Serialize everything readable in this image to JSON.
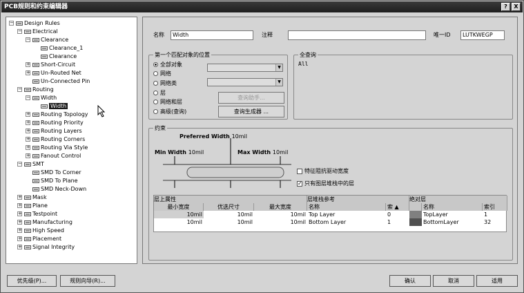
{
  "window": {
    "title": "PCB规则和约束编辑器",
    "help": "?",
    "close": "X"
  },
  "tree": [
    {
      "label": "Design Rules",
      "exp": "−",
      "lv": 0,
      "icon": "folder-icon"
    },
    {
      "label": "Electrical",
      "exp": "−",
      "lv": 1,
      "icon": "electrical-icon"
    },
    {
      "label": "Clearance",
      "exp": "−",
      "lv": 2,
      "icon": "clearance-icon"
    },
    {
      "label": "Clearance_1",
      "exp": "",
      "lv": 3,
      "icon": "rule-icon"
    },
    {
      "label": "Clearance",
      "exp": "",
      "lv": 3,
      "icon": "rule-icon"
    },
    {
      "label": "Short-Circuit",
      "exp": "+",
      "lv": 2,
      "icon": "rule-icon"
    },
    {
      "label": "Un-Routed Net",
      "exp": "+",
      "lv": 2,
      "icon": "rule-icon"
    },
    {
      "label": "Un-Connected Pin",
      "exp": "",
      "lv": 2,
      "icon": "rule-icon"
    },
    {
      "label": "Routing",
      "exp": "−",
      "lv": 1,
      "icon": "routing-icon"
    },
    {
      "label": "Width",
      "exp": "−",
      "lv": 2,
      "icon": "routing-icon"
    },
    {
      "label": "Width",
      "exp": "",
      "lv": 3,
      "icon": "width-icon",
      "selected": true
    },
    {
      "label": "Routing Topology",
      "exp": "+",
      "lv": 2,
      "icon": "routing-icon"
    },
    {
      "label": "Routing Priority",
      "exp": "+",
      "lv": 2,
      "icon": "routing-icon"
    },
    {
      "label": "Routing Layers",
      "exp": "+",
      "lv": 2,
      "icon": "routing-icon"
    },
    {
      "label": "Routing Corners",
      "exp": "+",
      "lv": 2,
      "icon": "routing-icon"
    },
    {
      "label": "Routing Via Style",
      "exp": "+",
      "lv": 2,
      "icon": "routing-icon"
    },
    {
      "label": "Fanout Control",
      "exp": "+",
      "lv": 2,
      "icon": "routing-icon"
    },
    {
      "label": "SMT",
      "exp": "−",
      "lv": 1,
      "icon": "smt-icon"
    },
    {
      "label": "SMD To Corner",
      "exp": "",
      "lv": 2,
      "icon": "smt-icon"
    },
    {
      "label": "SMD To Plane",
      "exp": "",
      "lv": 2,
      "icon": "smt-icon"
    },
    {
      "label": "SMD Neck-Down",
      "exp": "",
      "lv": 2,
      "icon": "smt-icon"
    },
    {
      "label": "Mask",
      "exp": "+",
      "lv": 1,
      "icon": "mask-icon"
    },
    {
      "label": "Plane",
      "exp": "+",
      "lv": 1,
      "icon": "plane-icon"
    },
    {
      "label": "Testpoint",
      "exp": "+",
      "lv": 1,
      "icon": "testpoint-icon"
    },
    {
      "label": "Manufacturing",
      "exp": "+",
      "lv": 1,
      "icon": "manufacturing-icon"
    },
    {
      "label": "High Speed",
      "exp": "+",
      "lv": 1,
      "icon": "highspeed-icon"
    },
    {
      "label": "Placement",
      "exp": "+",
      "lv": 1,
      "icon": "placement-icon"
    },
    {
      "label": "Signal Integrity",
      "exp": "+",
      "lv": 1,
      "icon": "signal-icon"
    }
  ],
  "rule": {
    "name_label": "名称",
    "name_value": "Width",
    "comment_label": "注释",
    "comment_value": "",
    "uid_label": "唯一ID",
    "uid_value": "LUTKWEGP"
  },
  "match": {
    "title": "第一个匹配对象的位置",
    "options": [
      "全部对象",
      "网络",
      "网络类",
      "层",
      "网络和层",
      "高级(查询)"
    ],
    "selected": 0,
    "query_helper": "查询助手...",
    "query_builder": "查询生成器 ..."
  },
  "query": {
    "title": "全查询",
    "text": "All"
  },
  "constraints": {
    "title": "约束",
    "preferred_label": "Preferred Width",
    "preferred_value": "10mil",
    "min_label": "Min Width",
    "min_value": "10mil",
    "max_label": "Max Width",
    "max_value": "10mil",
    "chk_impedance": "特征阻抗驱动宽度",
    "chk_impedance_checked": false,
    "chk_stack": "只有图层堆栈中的层",
    "chk_stack_checked": true
  },
  "table": {
    "group_layer": "层上属性",
    "group_stack": "层堆栈参考",
    "group_abs": "绝对层",
    "cols": [
      "最小宽度",
      "优选尺寸",
      "最大宽度",
      "名称",
      "索",
      "名称",
      "索引"
    ],
    "rows": [
      [
        "10mil",
        "10mil",
        "10mil",
        "Top Layer",
        "0",
        "TopLayer",
        "1"
      ],
      [
        "10mil",
        "10mil",
        "10mil",
        "Bottom Layer",
        "1",
        "BottomLayer",
        "32"
      ]
    ],
    "swatch_colors": [
      "#808080",
      "#505050"
    ]
  },
  "footer": {
    "priority": "优先级(P)...",
    "wizard": "规则向导(R)...",
    "ok": "确认",
    "cancel": "取消",
    "apply": "适用"
  }
}
